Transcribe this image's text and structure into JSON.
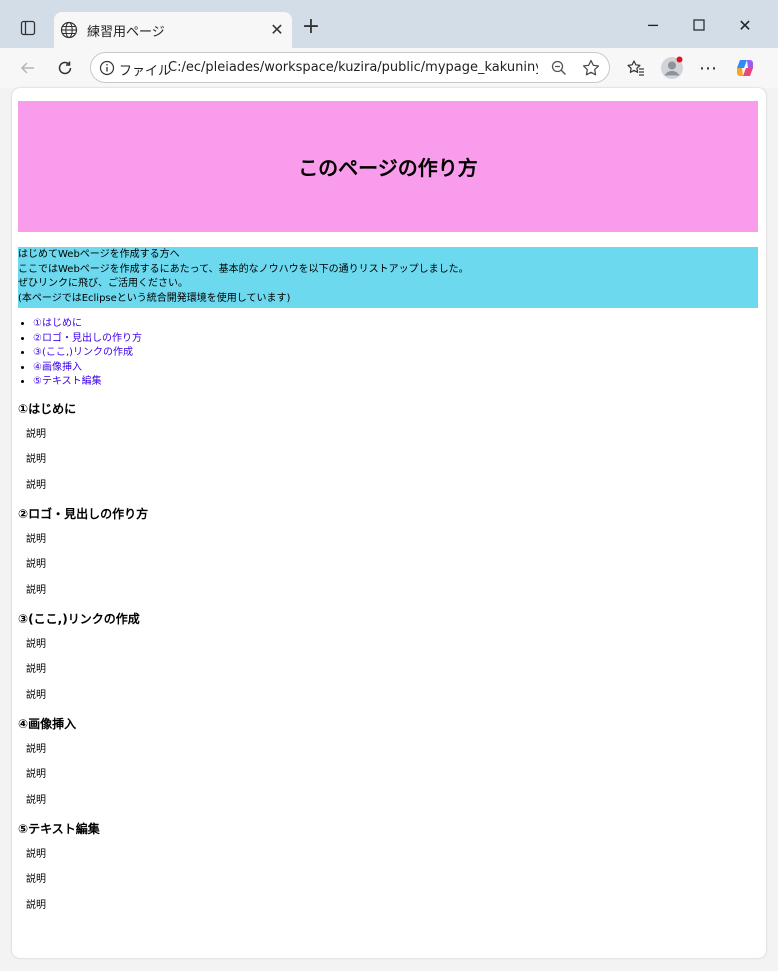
{
  "browser": {
    "tab_title": "練習用ページ",
    "address_prefix": "ファイル",
    "url": "C:/ec/pleiades/workspace/kuzira/public/mypage_kakuninyou.html",
    "icons": {
      "tab_actions": "tab-actions-icon",
      "tab_favicon": "globe-icon",
      "tab_close": "close-icon",
      "new_tab": "plus-icon",
      "minimize": "minimize-icon",
      "maximize": "maximize-icon",
      "close_window": "close-icon",
      "back": "arrow-left-icon",
      "reload": "reload-icon",
      "info": "info-icon",
      "zoom": "zoom-out-icon",
      "favorite": "star-icon",
      "favorites_list": "favorites-icon",
      "profile": "avatar-icon",
      "more": "more-icon",
      "copilot": "copilot-icon"
    }
  },
  "page": {
    "header_title": "このページの作り方",
    "header_color": "#f99cec",
    "intro_color": "#6cd9ee",
    "intro_lines": [
      "はじめてWebページを作成する方へ",
      "ここではWebページを作成するにあたって、基本的なノウハウを以下の通りリストアップしました。",
      "ぜひリンクに飛び、ご活用ください。",
      "(本ページではEclipseという統合開発環境を使用しています)"
    ],
    "toc": [
      "①はじめに",
      "②ロゴ・見出しの作り方",
      "③(ここ,)リンクの作成",
      "④画像挿入",
      "⑤テキスト編集"
    ],
    "sections": [
      {
        "title": "①はじめに",
        "items": [
          "説明",
          "説明",
          "説明"
        ]
      },
      {
        "title": "②ロゴ・見出しの作り方",
        "items": [
          "説明",
          "説明",
          "説明"
        ]
      },
      {
        "title": "③(ここ,)リンクの作成",
        "items": [
          "説明",
          "説明",
          "説明"
        ]
      },
      {
        "title": "④画像挿入",
        "items": [
          "説明",
          "説明",
          "説明"
        ]
      },
      {
        "title": "⑤テキスト編集",
        "items": [
          "説明",
          "説明",
          "説明"
        ]
      }
    ]
  }
}
